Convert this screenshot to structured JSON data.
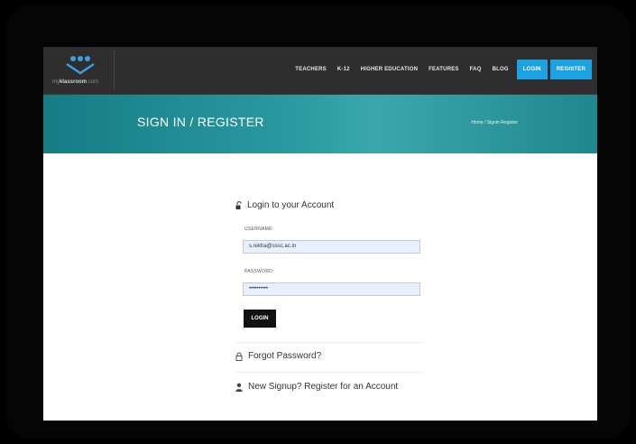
{
  "brand": {
    "prefix": "my",
    "name": "klassroom",
    "suffix": ".com"
  },
  "nav": {
    "items": [
      "TEACHERS",
      "K-12",
      "HIGHER EDUCATION",
      "FEATURES",
      "FAQ",
      "BLOG"
    ],
    "login": "LOGIN",
    "register": "REGISTER"
  },
  "banner": {
    "title": "SIGN IN / REGISTER",
    "breadcrumb": "Home / Signin-Register"
  },
  "form": {
    "heading": "Login to your Account",
    "username_label": "USERNAME:",
    "username_value": "s.rekha@sssc.ac.in",
    "password_label": "PASSWORD:",
    "password_value": "••••••••••",
    "login_button": "LOGIN"
  },
  "links": {
    "forgot": "Forgot Password?",
    "signup": "New Signup? Register for an Account"
  },
  "colors": {
    "topbar": "#2e2e2e",
    "accent": "#1ba2e3",
    "banner": "#2a9aa0"
  }
}
